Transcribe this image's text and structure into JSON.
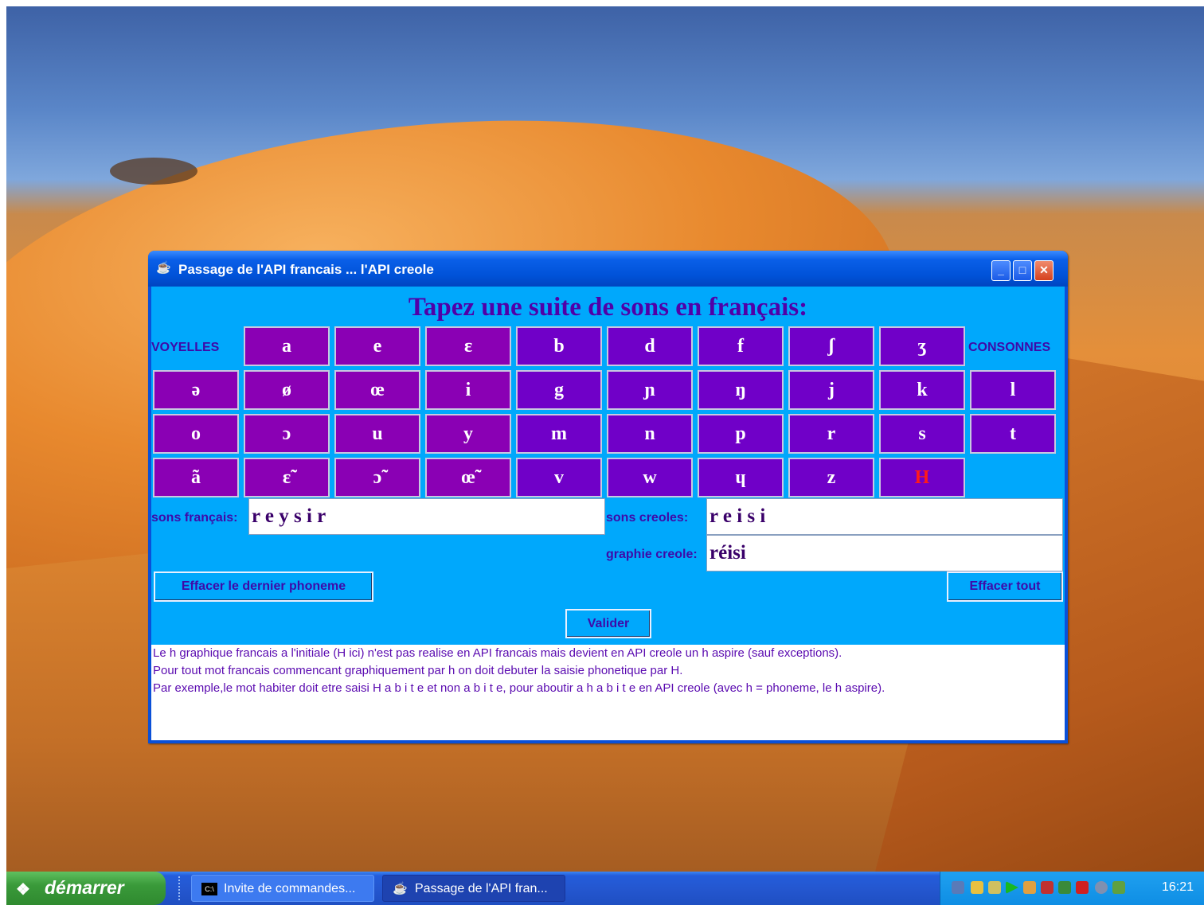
{
  "window": {
    "title": "Passage de l'API francais ... l'API creole",
    "minimize_label": "_",
    "maximize_label": "□",
    "close_label": "✕"
  },
  "heading": "Tapez une suite de sons en français:",
  "labels": {
    "voyelles": "VOYELLES",
    "consonnes": "CONSONNES",
    "sons_francais": "sons français:",
    "sons_creoles": "sons creoles:",
    "graphie_creole": "graphie creole:"
  },
  "keys": {
    "row1": [
      "a",
      "e",
      "ɛ",
      "b",
      "d",
      "f",
      "ʃ",
      "ʒ"
    ],
    "row2": [
      "ə",
      "ø",
      "œ",
      "i",
      "g",
      "ɲ",
      "ŋ",
      "j",
      "k",
      "l"
    ],
    "row3": [
      "o",
      "ɔ",
      "u",
      "y",
      "m",
      "n",
      "p",
      "r",
      "s",
      "t"
    ],
    "row4": [
      "ã",
      "ɛ̃",
      "ɔ̃",
      "œ̃",
      "v",
      "w",
      "ɥ",
      "z",
      "H"
    ]
  },
  "fields": {
    "sons_francais": "r e y s i r",
    "sons_creoles": "r e i s i",
    "graphie_creole": "réisi"
  },
  "buttons": {
    "effacer_dernier": "Effacer le dernier phoneme",
    "effacer_tout": "Effacer tout",
    "valider": "Valider"
  },
  "notes": [
    "Le h graphique francais a l'initiale (H ici) n'est pas realise en API francais mais devient en API creole un h aspire (sauf exceptions).",
    "Pour tout mot francais commencant graphiquement par h on doit debuter la saisie phonetique par H.",
    "Par exemple,le mot habiter doit etre saisi H a b i t e et non a b i t e, pour aboutir a  h a b i t e en API creole (avec h = phoneme, le h aspire)."
  ],
  "taskbar": {
    "start_label": "démarrer",
    "task1_label": "Invite de commandes...",
    "task1_icon": "C:\\",
    "task2_label": "Passage de l'API fran...",
    "clock": "16:21"
  },
  "colors": {
    "client_bg": "#00a8fc",
    "vowel_key": "#8a00b4",
    "consonant_key": "#7000c8",
    "heading": "#5000a8",
    "h_key_text": "#ff1a1a"
  }
}
